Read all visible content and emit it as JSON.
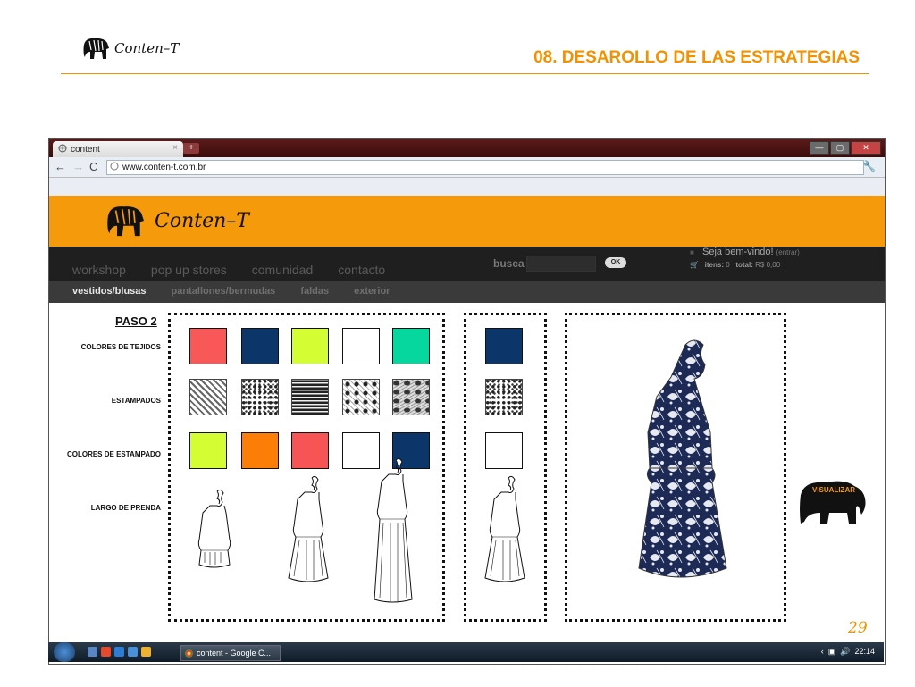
{
  "slide": {
    "logo_text": "Conten–T",
    "title": "08. DESAROLLO DE LAS ESTRATEGIAS",
    "page_number": "29"
  },
  "browser": {
    "tab_title": "content",
    "tab_close": "×",
    "new_tab": "+",
    "url": "www.conten-t.com.br",
    "window_controls": {
      "minimize": "—",
      "maximize": "▢",
      "close": "✕"
    }
  },
  "site": {
    "logo_text": "Conten–T",
    "nav_primary": [
      "workshop",
      "pop up stores",
      "comunidad",
      "contacto"
    ],
    "search_label": "busca",
    "search_button": "OK",
    "welcome_text": "Seja bem-vindo!",
    "welcome_link": "(entrar)",
    "cart_items_label": "itens:",
    "cart_items_value": "0",
    "cart_total_label": "total:",
    "cart_total_value": "R$ 0,00",
    "nav_secondary": [
      "vestidos/blusas",
      "pantallones/bermudas",
      "faldas",
      "exterior"
    ],
    "active_secondary": "vestidos/blusas"
  },
  "builder": {
    "step": "PASO 2",
    "labels": {
      "fabric_colors": "COLORES DE TEJIDOS",
      "prints": "ESTAMPADOS",
      "print_colors": "COLORES DE ESTAMPADO",
      "length": "LARGO DE PRENDA"
    },
    "fabric_colors": [
      "#f85857",
      "#0c356a",
      "#d4fd34",
      "#ffffff",
      "#06d79e"
    ],
    "prints": [
      "geometric",
      "floral-speckle",
      "stripes",
      "damask",
      "floral-large"
    ],
    "print_colors": [
      "#d4fd34",
      "#fd7e07",
      "#f75455",
      "#ffffff",
      "#0c356a"
    ],
    "lengths": [
      "short",
      "knee",
      "long"
    ],
    "selected": {
      "fabric_color": "#0c356a",
      "print": "floral-speckle",
      "print_color": "#ffffff",
      "length": "knee"
    },
    "visualize_button": "VISUALIZAR"
  },
  "taskbar": {
    "window_title": "content - Google C...",
    "clock": "22:14"
  }
}
